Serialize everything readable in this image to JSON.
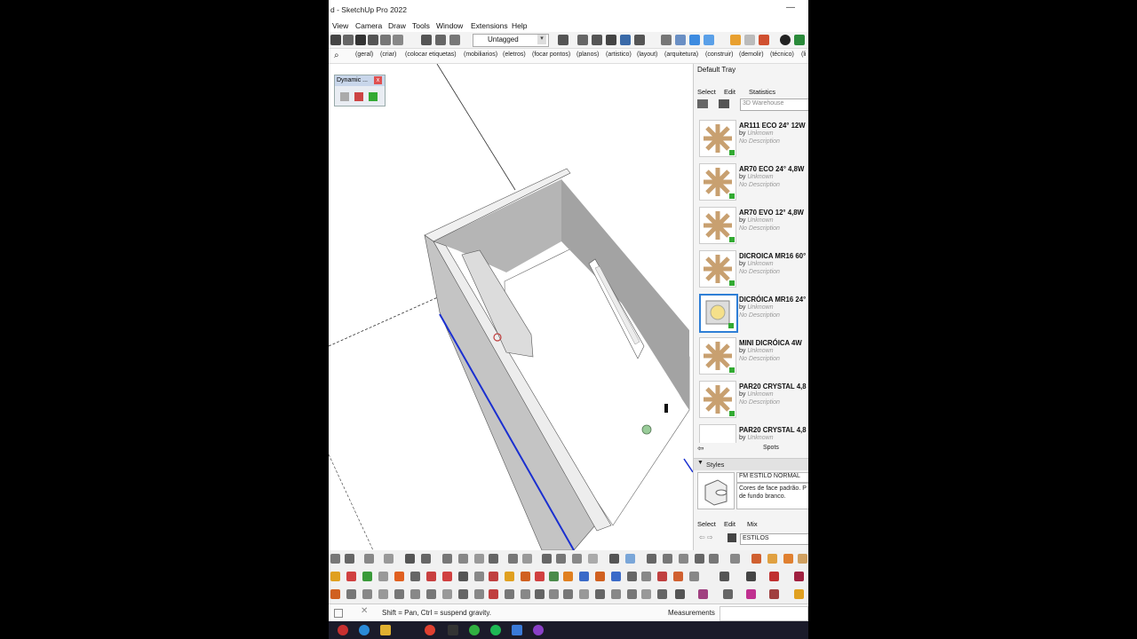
{
  "window": {
    "title": "d - SketchUp Pro 2022",
    "minimize_glyph": "—"
  },
  "menu": [
    "View",
    "Camera",
    "Draw",
    "Tools",
    "Window",
    "Extensions",
    "Help"
  ],
  "toolbar": {
    "layer_value": "Untagged"
  },
  "tags": [
    "(geral)",
    "(criar)",
    "(colocar etiquetas)",
    "(mobiliarios)",
    "(eletros)",
    "(focar pontos)",
    "(planos)",
    "(artistico)",
    "(layout)",
    "(arquitetura)",
    "(construir)",
    "(demolir)",
    "(técnico)",
    "(li"
  ],
  "dynamic_panel": {
    "title": "Dynamic ...",
    "close": "x"
  },
  "tray": {
    "title": "Default Tray",
    "components": {
      "tabs": [
        "Select",
        "Edit",
        "Statistics"
      ],
      "search_value": "3D Warehouse",
      "items": [
        {
          "name": "AR111 ECO 24° 12W",
          "by": "by",
          "author": "Unknown",
          "desc": "No Description"
        },
        {
          "name": "AR70 ECO 24° 4,8W",
          "by": "by",
          "author": "Unknown",
          "desc": "No Description"
        },
        {
          "name": "AR70 EVO 12° 4,8W",
          "by": "by",
          "author": "Unknown",
          "desc": "No Description"
        },
        {
          "name": "DICROICA MR16 60°",
          "by": "by",
          "author": "Unknown",
          "desc": "No Description"
        },
        {
          "name": "DICRÓICA MR16 24°",
          "by": "by",
          "author": "Unknown",
          "desc": "No Description"
        },
        {
          "name": "MINI DICRÓICA 4W",
          "by": "by",
          "author": "Unknown",
          "desc": "No Description"
        },
        {
          "name": "PAR20 CRYSTAL 4,8",
          "by": "by",
          "author": "Unknown",
          "desc": "No Description"
        },
        {
          "name": "PAR20 CRYSTAL 4,8",
          "by": "by",
          "author": "Unknown",
          "desc": ""
        }
      ],
      "footer_label": "Spots"
    },
    "styles": {
      "header": "Styles",
      "style_name": "FM ESTILO NORMAL",
      "style_desc": "Cores de face padrão. P de fundo branco.",
      "tabs": [
        "Select",
        "Edit",
        "Mix"
      ],
      "collection": "ESTILOS"
    }
  },
  "status": {
    "hint": "Shift = Pan, Ctrl = suspend gravity.",
    "measurements_label": "Measurements"
  },
  "colors": {
    "tray_selected": "#2f7fd6",
    "edge_blue": "#1a2fd0",
    "wall_grey": "#bdbdbd"
  }
}
